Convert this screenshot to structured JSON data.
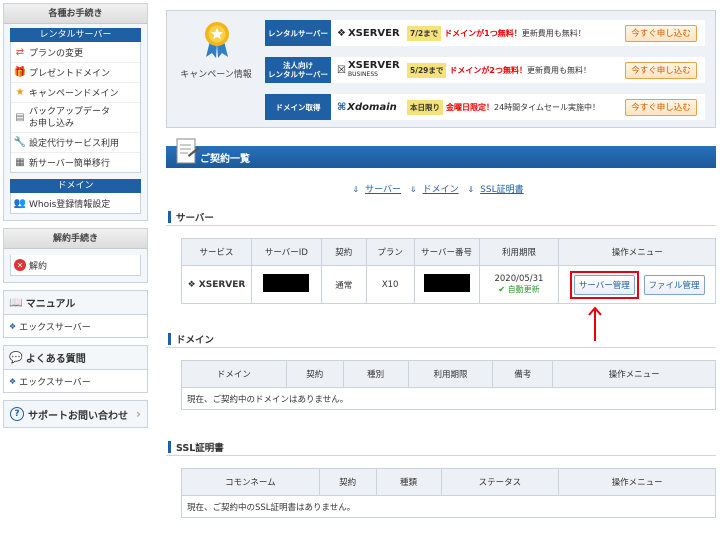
{
  "sidebar": {
    "procedures_title": "各種お手続き",
    "rental_server_head": "レンタルサーバー",
    "rental_items": [
      "プランの変更",
      "プレゼントドメイン",
      "キャンペーンドメイン",
      "バックアップデータ",
      "お申し込み",
      "設定代行サービス利用",
      "新サーバー簡単移行"
    ],
    "domain_head": "ドメイン",
    "domain_items": [
      "Whois登録情報設定"
    ],
    "cancel_title": "解約手続き",
    "cancel_item": "解約",
    "manual_title": "マニュアル",
    "manual_item": "エックスサーバー",
    "faq_title": "よくある質問",
    "faq_item": "エックスサーバー",
    "support": "サポートお問い合わせ"
  },
  "campaign": {
    "label": "キャンペーン情報",
    "rows": [
      {
        "tag": "レンタルサーバー",
        "brand": "XSERVER",
        "brand_sub": "",
        "date": "7/2まで",
        "highlight": "ドメインが1つ無料！",
        "text": "更新費用も無料！",
        "button": "今すぐ申し込む"
      },
      {
        "tag": "法人向け\nレンタルサーバー",
        "brand": "XSERVER",
        "brand_sub": "BUSINESS",
        "date": "5/29まで",
        "highlight": "ドメインが2つ無料！",
        "text": "更新費用も無料！",
        "button": "今すぐ申し込む"
      },
      {
        "tag": "ドメイン取得",
        "brand": "Xdomain",
        "brand_sub": "",
        "date": "本日限り",
        "highlight": "金曜日限定！",
        "text": "24時間タイムセール実施中！",
        "button": "今すぐ申し込む"
      }
    ]
  },
  "contract": {
    "title": "ご契約一覧",
    "links": [
      "サーバー",
      "ドメイン",
      "SSL証明書"
    ]
  },
  "server_section": {
    "title": "サーバー",
    "headers": [
      "サービス",
      "サーバーID",
      "契約",
      "プラン",
      "サーバー番号",
      "利用期限",
      "操作メニュー"
    ],
    "row": {
      "service": "XSERVER",
      "contract": "通常",
      "plan": "X10",
      "expiry": "2020/05/31",
      "renew": "自動更新",
      "btn_manage": "サーバー管理",
      "btn_file": "ファイル管理"
    }
  },
  "domain_section": {
    "title": "ドメイン",
    "headers": [
      "ドメイン",
      "契約",
      "種別",
      "利用期限",
      "備考",
      "操作メニュー"
    ],
    "empty": "現在、ご契約中のドメインはありません。"
  },
  "ssl_section": {
    "title": "SSL証明書",
    "headers": [
      "コモンネーム",
      "契約",
      "種類",
      "ステータス",
      "操作メニュー"
    ],
    "empty": "現在、ご契約中のSSL証明書はありません。"
  },
  "colors": {
    "accent": "#1f5fa4",
    "highlight_red": "#e8000b"
  }
}
